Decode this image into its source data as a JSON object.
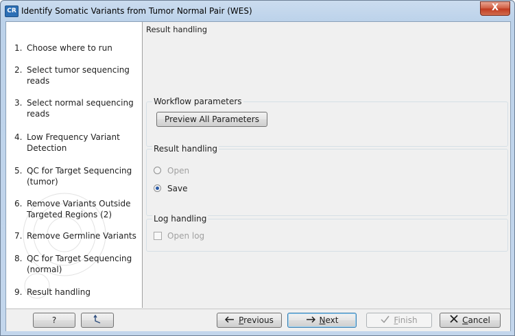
{
  "window": {
    "app_icon_text": "CR",
    "title": "Identify Somatic Variants from Tumor Normal Pair (WES)",
    "close_glyph": "X"
  },
  "steps": [
    {
      "num": "1.",
      "label": "Choose where to run"
    },
    {
      "num": "2.",
      "label": "Select tumor sequencing reads"
    },
    {
      "num": "3.",
      "label": "Select normal sequencing reads"
    },
    {
      "num": "4.",
      "label": "Low Frequency Variant Detection"
    },
    {
      "num": "5.",
      "label": "QC for Target Sequencing (tumor)"
    },
    {
      "num": "6.",
      "label": "Remove Variants Outside Targeted Regions (2)"
    },
    {
      "num": "7.",
      "label": "Remove Germline Variants"
    },
    {
      "num": "8.",
      "label": "QC for Target Sequencing (normal)"
    },
    {
      "num": "9.",
      "label": "Result handling"
    }
  ],
  "main": {
    "heading": "Result handling",
    "workflow_parameters": {
      "title": "Workflow parameters",
      "preview_button": "Preview All Parameters"
    },
    "result_handling": {
      "title": "Result handling",
      "open_label": "Open",
      "save_label": "Save",
      "selected": "Save"
    },
    "log_handling": {
      "title": "Log handling",
      "open_log_label": "Open log",
      "open_log_checked": false
    }
  },
  "buttons": {
    "help": "?",
    "previous_first": "P",
    "previous_rest": "revious",
    "next_first": "N",
    "next_rest": "ext",
    "finish_first": "F",
    "finish_rest": "inish",
    "cancel_first": "C",
    "cancel_rest": "ancel"
  },
  "icons": {
    "help": "help-icon",
    "reset": "reset-arrow-icon",
    "previous": "arrow-left-icon",
    "next": "arrow-right-icon",
    "finish": "checkmark-icon",
    "cancel": "x-icon"
  },
  "colors": {
    "title_bar": "#bcd2ea",
    "close_button": "#c0391f",
    "radio_selected": "#2a5aa5",
    "primary_button_border": "#3c7fb1"
  }
}
